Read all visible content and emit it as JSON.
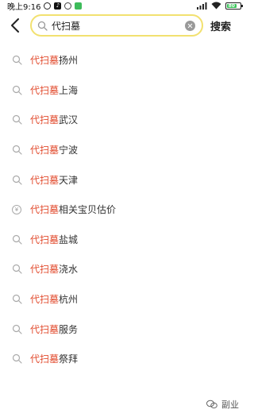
{
  "status_bar": {
    "time": "晚上9:16",
    "battery_level": "80",
    "battery_fraction": 0.75,
    "icons": [
      "alarm-icon",
      "tiktok-icon",
      "baby-icon",
      "wechat-icon",
      "signal-icon",
      "wifi-icon",
      "battery-icon"
    ]
  },
  "search": {
    "query": "代扫墓",
    "button_label": "搜索"
  },
  "suggestions": [
    {
      "keyword": "代扫墓",
      "rest": "扬州",
      "icon": "search-icon"
    },
    {
      "keyword": "代扫墓",
      "rest": "上海",
      "icon": "search-icon"
    },
    {
      "keyword": "代扫墓",
      "rest": "武汉",
      "icon": "search-icon"
    },
    {
      "keyword": "代扫墓",
      "rest": "宁波",
      "icon": "search-icon"
    },
    {
      "keyword": "代扫墓",
      "rest": "天津",
      "icon": "search-icon"
    },
    {
      "keyword": "代扫墓",
      "rest": "相关宝贝估价",
      "icon": "price-icon"
    },
    {
      "keyword": "代扫墓",
      "rest": "盐城",
      "icon": "search-icon"
    },
    {
      "keyword": "代扫墓",
      "rest": "浇水",
      "icon": "search-icon"
    },
    {
      "keyword": "代扫墓",
      "rest": "杭州",
      "icon": "search-icon"
    },
    {
      "keyword": "代扫墓",
      "rest": "服务",
      "icon": "search-icon"
    },
    {
      "keyword": "代扫墓",
      "rest": "祭拜",
      "icon": "search-icon"
    }
  ],
  "price_icon_glyph": "¥",
  "watermark": {
    "text": "副业"
  },
  "colors": {
    "keyword": "#e24b2e",
    "search_border": "#f2e170"
  }
}
